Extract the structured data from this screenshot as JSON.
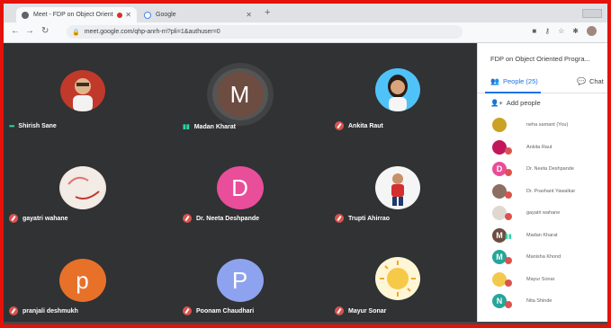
{
  "browser": {
    "tabs": [
      {
        "label": "Meet - FDP on Object Orient",
        "active": true
      },
      {
        "label": "Google",
        "active": false
      }
    ],
    "url": "meet.google.com/qhp-anrh-rri?pli=1&authuser=0"
  },
  "colors": {
    "frame_border": "#e3120b",
    "grid_bg": "#303234",
    "accent": "#1a73e8",
    "muted_red": "#d9534f",
    "speaking_teal": "#2bd4a4"
  },
  "participants": [
    {
      "name": "Shirish Sane",
      "status": "speaking-dots",
      "avatar": "photo"
    },
    {
      "name": "Madan Kharat",
      "status": "speaking-bars",
      "initial": "M",
      "color": "#6d4c41"
    },
    {
      "name": "Ankita Raut",
      "status": "muted",
      "avatar": "photo"
    },
    {
      "name": "gayatri wahane",
      "status": "muted",
      "avatar": "image"
    },
    {
      "name": "Dr. Neeta Deshpande",
      "status": "muted",
      "initial": "D",
      "color": "#e94e9a"
    },
    {
      "name": "Trupti Ahirrao",
      "status": "muted",
      "avatar": "photo"
    },
    {
      "name": "pranjali deshmukh",
      "status": "muted",
      "initial": "p",
      "color": "#e8712a"
    },
    {
      "name": "Poonam Chaudhari",
      "status": "muted",
      "initial": "P",
      "color": "#8ea3f0"
    },
    {
      "name": "Mayur Sonar",
      "status": "muted",
      "avatar": "image"
    }
  ],
  "panel": {
    "title": "FDP on Object Oriented Progra...",
    "people_tab": "People (25)",
    "chat_tab": "Chat",
    "add_people": "Add people",
    "list": [
      {
        "name": "neha samant (You)",
        "initial": "",
        "color": "#c9a227",
        "badge": "none"
      },
      {
        "name": "Ankita Raut",
        "initial": "",
        "color": "#c2185b",
        "badge": "muted"
      },
      {
        "name": "Dr. Neeta Deshpande",
        "initial": "D",
        "color": "#e94e9a",
        "badge": "muted"
      },
      {
        "name": "Dr. Prashant Yawalkar",
        "initial": "",
        "color": "#8d6e63",
        "badge": "muted"
      },
      {
        "name": "gayatri wahane",
        "initial": "",
        "color": "#e0d7d0",
        "badge": "muted"
      },
      {
        "name": "Madan Kharat",
        "initial": "M",
        "color": "#6d4c41",
        "badge": "talk"
      },
      {
        "name": "Manisha Khond",
        "initial": "M",
        "color": "#26a69a",
        "badge": "muted"
      },
      {
        "name": "Mayur Sonar",
        "initial": "",
        "color": "#f2c94c",
        "badge": "muted"
      },
      {
        "name": "Nita Shinde",
        "initial": "N",
        "color": "#26a69a",
        "badge": "muted"
      }
    ]
  }
}
